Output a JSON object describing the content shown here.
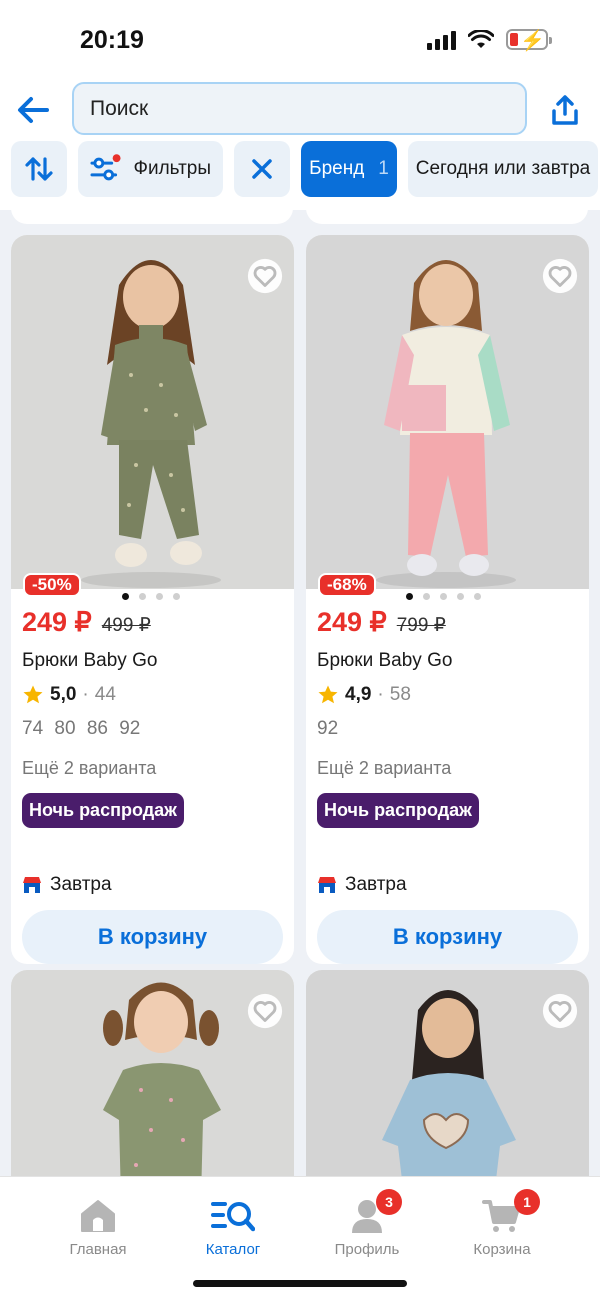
{
  "status_bar": {
    "time": "20:19"
  },
  "header": {
    "search_placeholder": "Поиск",
    "chips": {
      "filters_label": "Фильтры",
      "brand_label": "Бренд",
      "brand_count": "1",
      "delivery_label": "Сегодня или завтра"
    }
  },
  "products": [
    {
      "discount": "-50%",
      "price": "249 ₽",
      "old_price": "499 ₽",
      "title": "Брюки Baby Go",
      "rating": "5,0",
      "reviews": "44",
      "sizes": "74 80 86 92",
      "variants": "Ещё 2 варианта",
      "promo": "Ночь распродаж",
      "delivery": "Завтра",
      "cart_label": "В корзину",
      "photo_bg": "#d9d9d7",
      "outfit": "olive"
    },
    {
      "discount": "-68%",
      "price": "249 ₽",
      "old_price": "799 ₽",
      "title": "Брюки Baby Go",
      "rating": "4,9",
      "reviews": "58",
      "sizes": "92",
      "variants": "Ещё 2 варианта",
      "promo": "Ночь распродаж",
      "delivery": "Завтра",
      "cart_label": "В корзину",
      "photo_bg": "#d6d6d6",
      "outfit": "pink"
    }
  ],
  "tabbar": {
    "home": "Главная",
    "catalog": "Каталог",
    "profile": "Профиль",
    "profile_badge": "3",
    "cart": "Корзина",
    "cart_badge": "1"
  },
  "colors": {
    "accent": "#0a6fd9",
    "sale": "#e8302a",
    "promo": "#4a1d6b"
  }
}
